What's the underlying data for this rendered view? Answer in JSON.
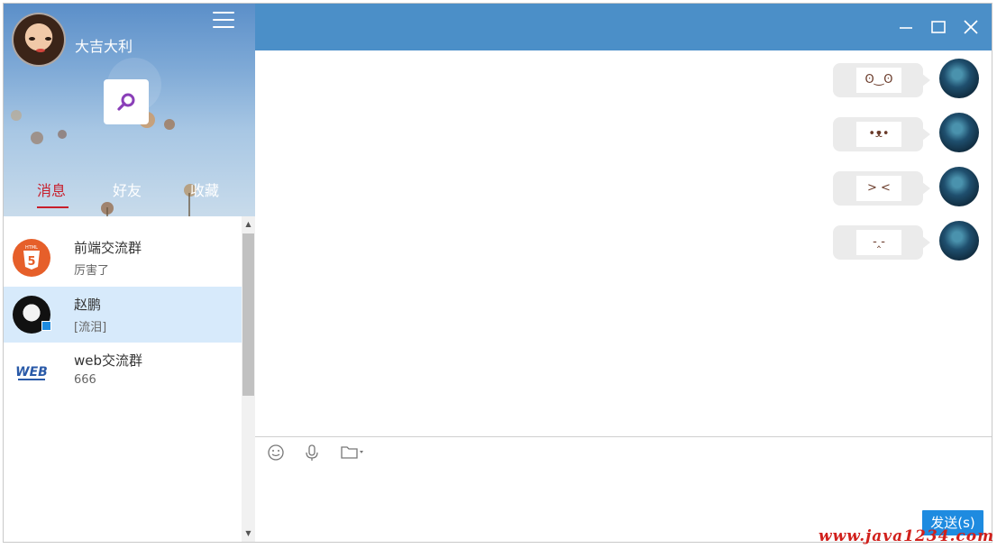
{
  "profile": {
    "user_name": "大吉大利"
  },
  "tabs": [
    {
      "label": "消息"
    },
    {
      "label": "好友"
    },
    {
      "label": "收藏"
    }
  ],
  "conversations": [
    {
      "name": "前端交流群",
      "last_message": "厉害了",
      "avatar": "html5-logo-icon"
    },
    {
      "name": "赵鹏",
      "last_message": "[流泪]",
      "avatar": "user-avatar"
    },
    {
      "name": "web交流群",
      "last_message": "666",
      "avatar": "web-logo-icon"
    }
  ],
  "messages": [
    {
      "emoji": "ʘ‿ʘ"
    },
    {
      "emoji": "•ᴥ•"
    },
    {
      "emoji": "> <"
    },
    {
      "emoji": "-‸-"
    }
  ],
  "composer": {
    "send_label": "发送(s)"
  },
  "watermark": "www.java1234.com",
  "colors": {
    "topbar": "#4b8fc8",
    "active_tab": "#c81e2b",
    "selected_row": "#d7eafb",
    "send_button": "#1e8be0"
  }
}
